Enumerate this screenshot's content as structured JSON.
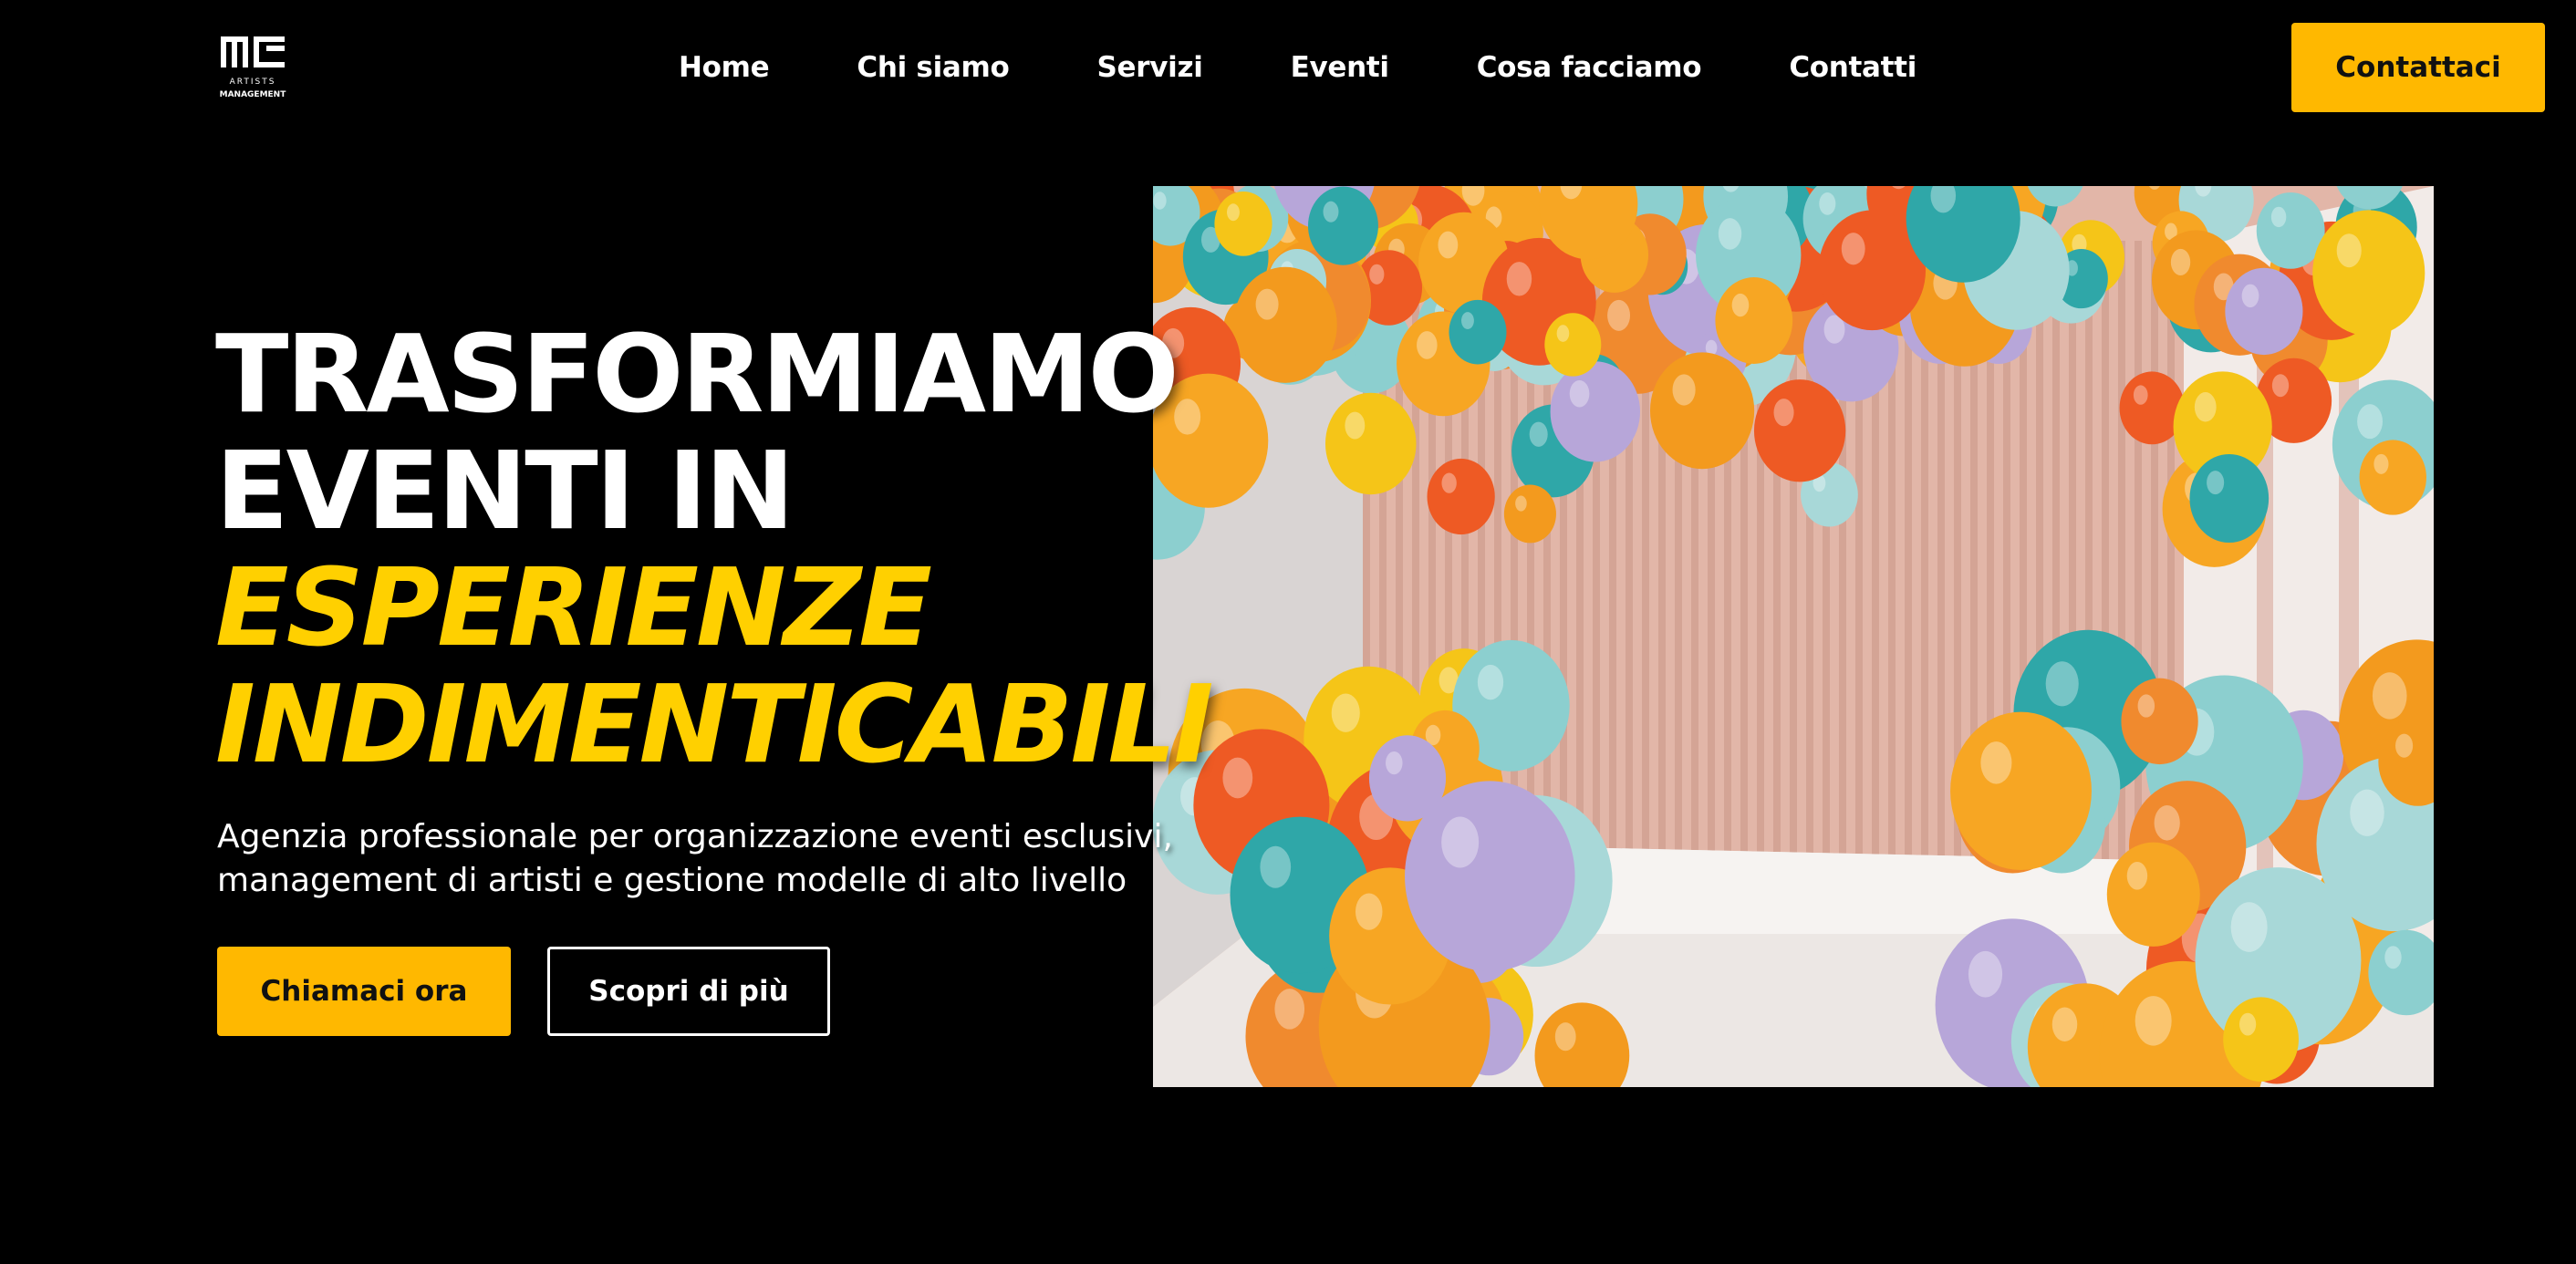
{
  "brand": {
    "logo_monogram": "MC",
    "logo_subtitle_1": "ARTISTS",
    "logo_subtitle_2": "MANAGEMENT"
  },
  "nav": {
    "items": [
      {
        "label": "Home"
      },
      {
        "label": "Chi siamo"
      },
      {
        "label": "Servizi"
      },
      {
        "label": "Eventi"
      },
      {
        "label": "Cosa facciamo"
      },
      {
        "label": "Contatti"
      }
    ],
    "cta_label": "Contattaci"
  },
  "hero": {
    "headline_line1": "TRASFORMIAMO",
    "headline_line2": "EVENTI IN",
    "headline_line3": "ESPERIENZE",
    "headline_line4": "INDIMENTICABILI",
    "subtitle_line1": "Agenzia professionale per organizzazione eventi esclusivi,",
    "subtitle_line2": "management di artisti e gestione modelle di alto livello",
    "primary_button": "Chiamaci ora",
    "secondary_button": "Scopri di più",
    "image": "balloon-decorated-event-hall"
  },
  "colors": {
    "background": "#000000",
    "accent_yellow": "#FFB800",
    "headline_yellow": "#FFD000",
    "text": "#FFFFFF"
  }
}
